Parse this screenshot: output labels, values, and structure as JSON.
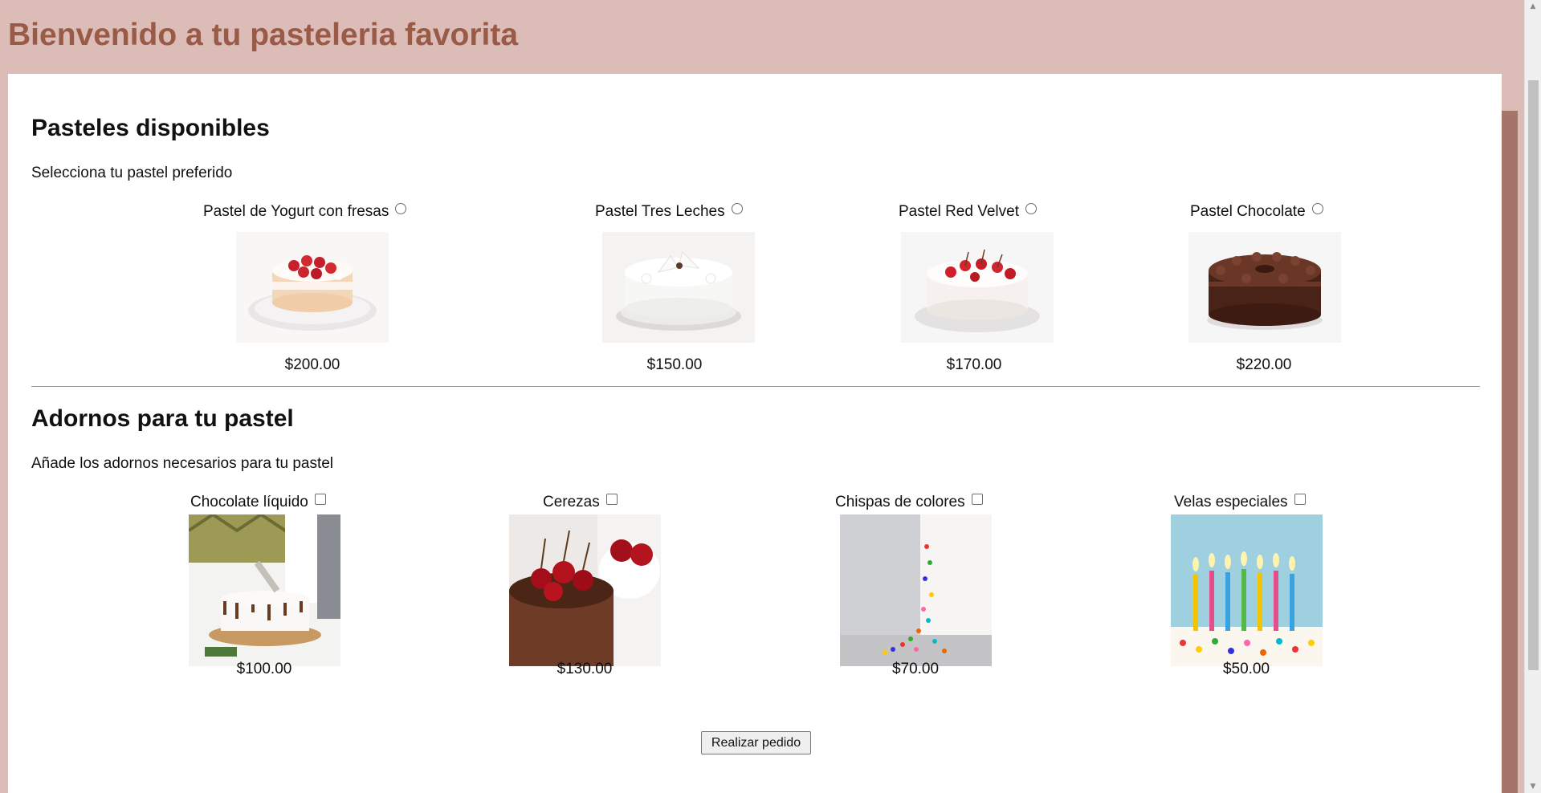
{
  "header": {
    "title": "Bienvenido a tu pasteleria favorita"
  },
  "cakes": {
    "heading": "Pasteles disponibles",
    "subtitle": "Selecciona tu pastel preferido",
    "items": [
      {
        "label": "Pastel de Yogurt con fresas",
        "price": "$200.00",
        "selected": false
      },
      {
        "label": "Pastel Tres Leches",
        "price": "$150.00",
        "selected": false
      },
      {
        "label": "Pastel Red Velvet",
        "price": "$170.00",
        "selected": false
      },
      {
        "label": "Pastel Chocolate",
        "price": "$220.00",
        "selected": false
      }
    ]
  },
  "toppings": {
    "heading": "Adornos para tu pastel",
    "subtitle": "Añade los adornos necesarios para tu pastel",
    "items": [
      {
        "label": "Chocolate líquido",
        "price": "$100.00",
        "checked": false
      },
      {
        "label": "Cerezas",
        "price": "$130.00",
        "checked": false
      },
      {
        "label": "Chispas de colores",
        "price": "$70.00",
        "checked": false
      },
      {
        "label": "Velas especiales",
        "price": "$50.00",
        "checked": false
      }
    ]
  },
  "actions": {
    "order_label": "Realizar pedido"
  },
  "colors": {
    "page_background": "#dbbcb6",
    "title_color": "#9a5a48",
    "accent_band": "#a6756a"
  }
}
